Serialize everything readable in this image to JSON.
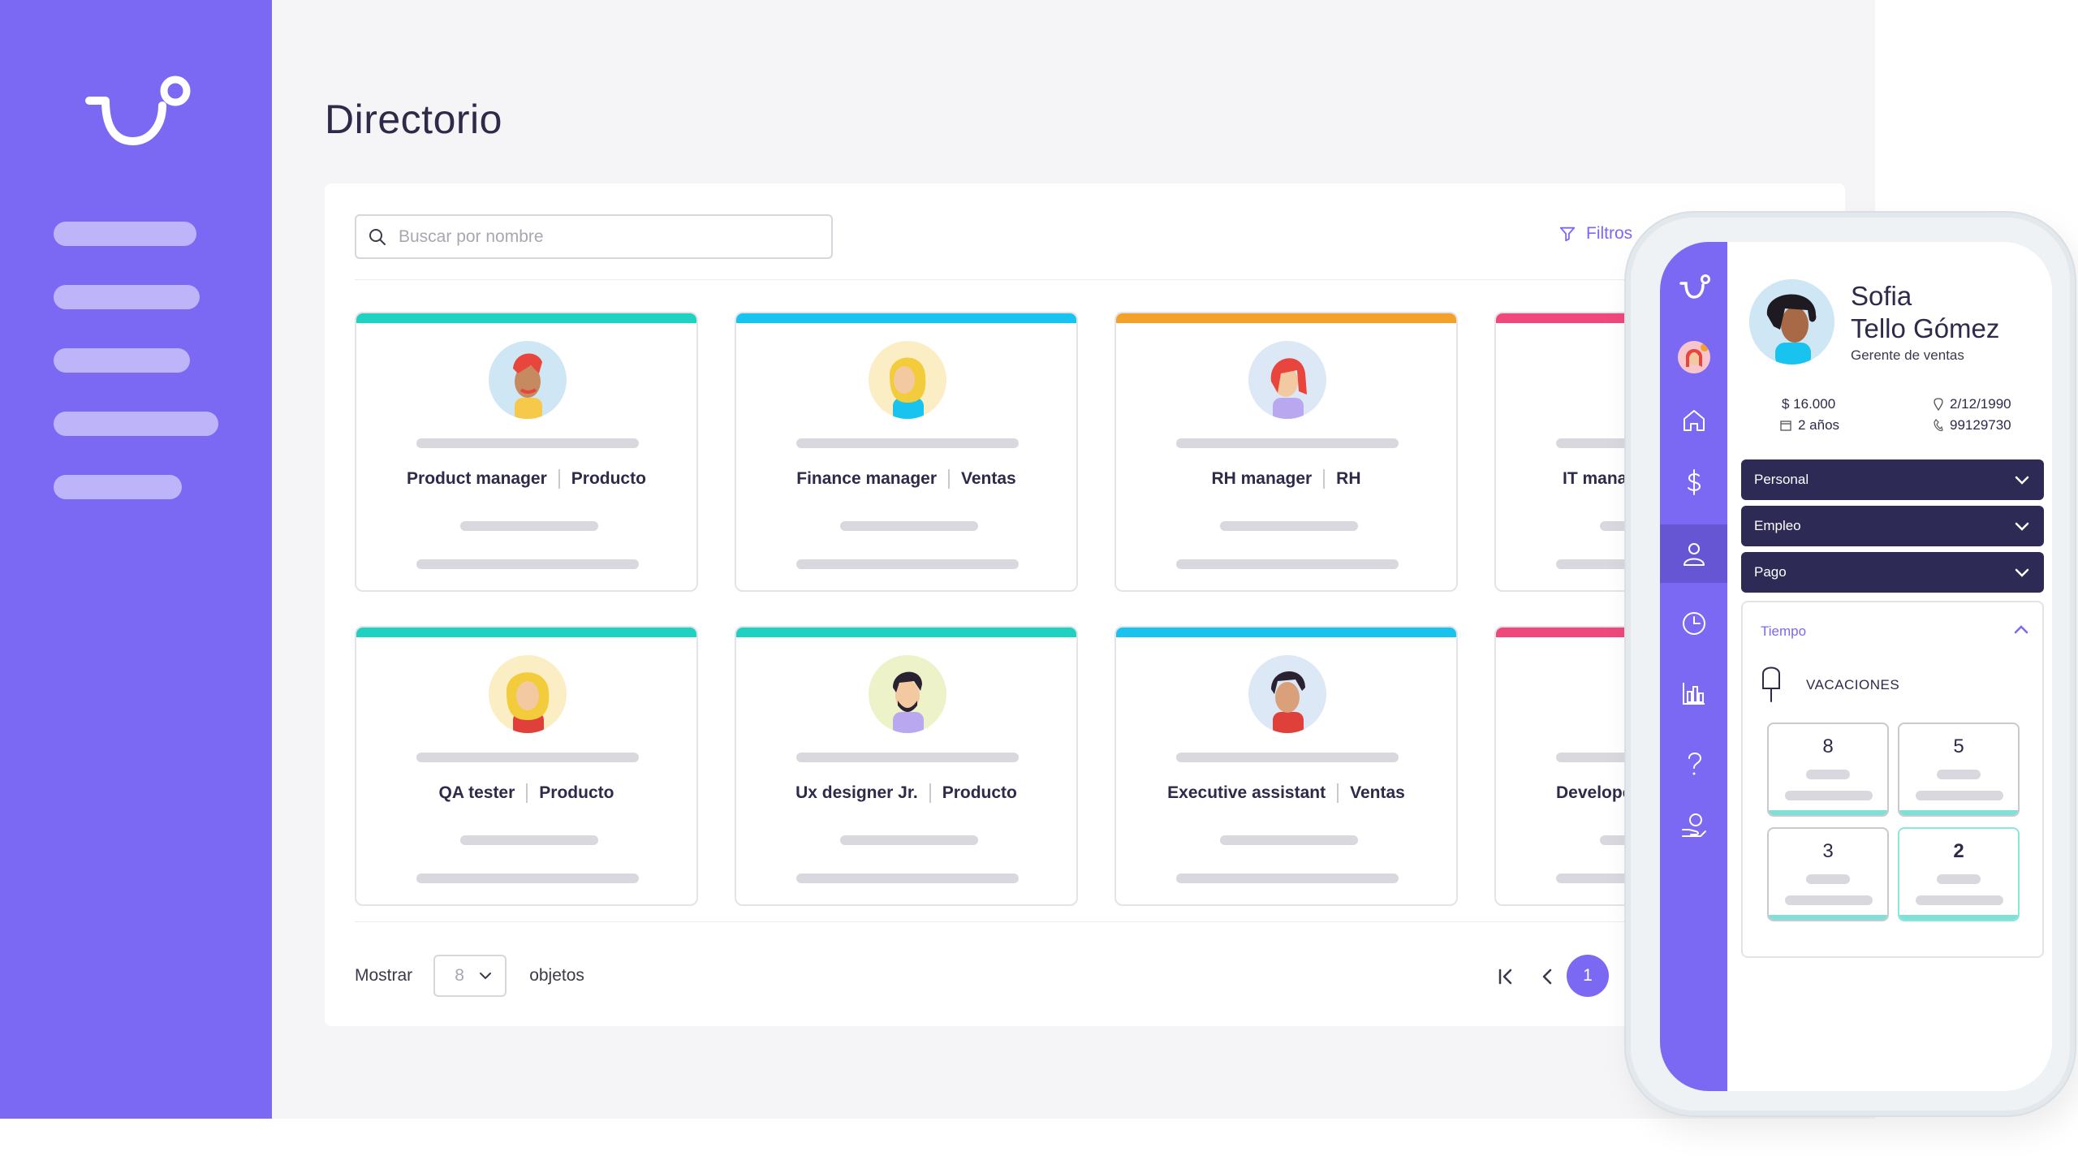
{
  "app": {
    "title": "Directorio"
  },
  "search": {
    "placeholder": "Buscar por nombre"
  },
  "filters": {
    "label": "Filtros"
  },
  "cards": [
    {
      "role": "Product manager",
      "dept": "Producto",
      "color": "#1fd1c1",
      "avatar": "red-haired-man"
    },
    {
      "role": "Finance manager",
      "dept": "Ventas",
      "color": "#19c3f0",
      "avatar": "blonde-woman"
    },
    {
      "role": "RH manager",
      "dept": "RH",
      "color": "#f2a12a",
      "avatar": "red-haired-woman"
    },
    {
      "role": "IT manage",
      "dept": "",
      "color": "#f0487c",
      "avatar": "dark-haired-person"
    },
    {
      "role": "QA tester",
      "dept": "Producto",
      "color": "#1fd1c1",
      "avatar": "blonde-curly-woman"
    },
    {
      "role": "Ux designer Jr.",
      "dept": "Producto",
      "color": "#1fd1c1",
      "avatar": "bearded-man"
    },
    {
      "role": "Executive assistant",
      "dept": "Ventas",
      "color": "#19c3f0",
      "avatar": "dark-haired-man"
    },
    {
      "role": "Developer",
      "dept": "",
      "color": "#f0487c",
      "avatar": "person"
    }
  ],
  "pager": {
    "show_label": "Mostrar",
    "per_page": "8",
    "items_label": "objetos",
    "current_page": "1"
  },
  "phone": {
    "first_name": "Sofia",
    "last_name": "Tello Gómez",
    "job": "Gerente de ventas",
    "salary": "$  16.000",
    "tenure": "2 años",
    "birthdate": "2/12/1990",
    "phone": "99129730",
    "accordions": [
      "Personal",
      "Empleo",
      "Pago"
    ],
    "time_section": {
      "title": "Tiempo",
      "vacations_label": "VACACIONES",
      "values": [
        "8",
        "5",
        "3",
        "2"
      ]
    }
  },
  "colors": {
    "brand": "#7b68f3",
    "dark": "#2e2a56",
    "teal": "#1fd1c1",
    "blue": "#19c3f0",
    "orange": "#f2a12a",
    "pink": "#f0487c"
  }
}
